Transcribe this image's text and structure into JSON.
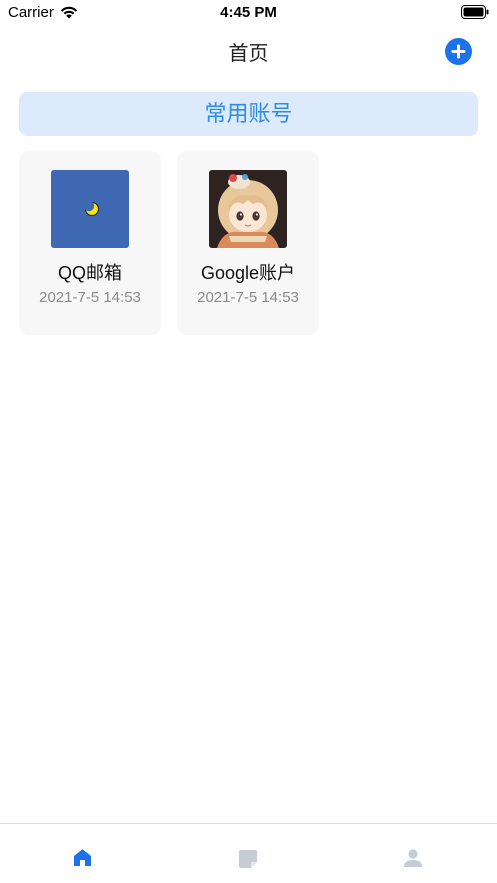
{
  "status_bar": {
    "carrier": "Carrier",
    "time": "4:45 PM"
  },
  "nav": {
    "title": "首页",
    "add_icon": "plus-circle-icon"
  },
  "section": {
    "title": "常用账号"
  },
  "accounts": [
    {
      "name": "QQ邮箱",
      "time": "2021-7-5 14:53",
      "icon": "qq-mail-icon",
      "icon_color": "#3f6ab3"
    },
    {
      "name": "Google账户",
      "time": "2021-7-5 14:53",
      "icon": "anime-avatar-image"
    }
  ],
  "tab_bar": {
    "items": [
      {
        "icon": "home-icon",
        "active": true
      },
      {
        "icon": "note-icon",
        "active": false
      },
      {
        "icon": "person-icon",
        "active": false
      }
    ],
    "active_color": "#1a73e8",
    "inactive_color": "#c5ccd6"
  },
  "colors": {
    "accent": "#1a73e8",
    "banner_bg": "#ddeafc",
    "banner_text": "#2d8de6"
  }
}
